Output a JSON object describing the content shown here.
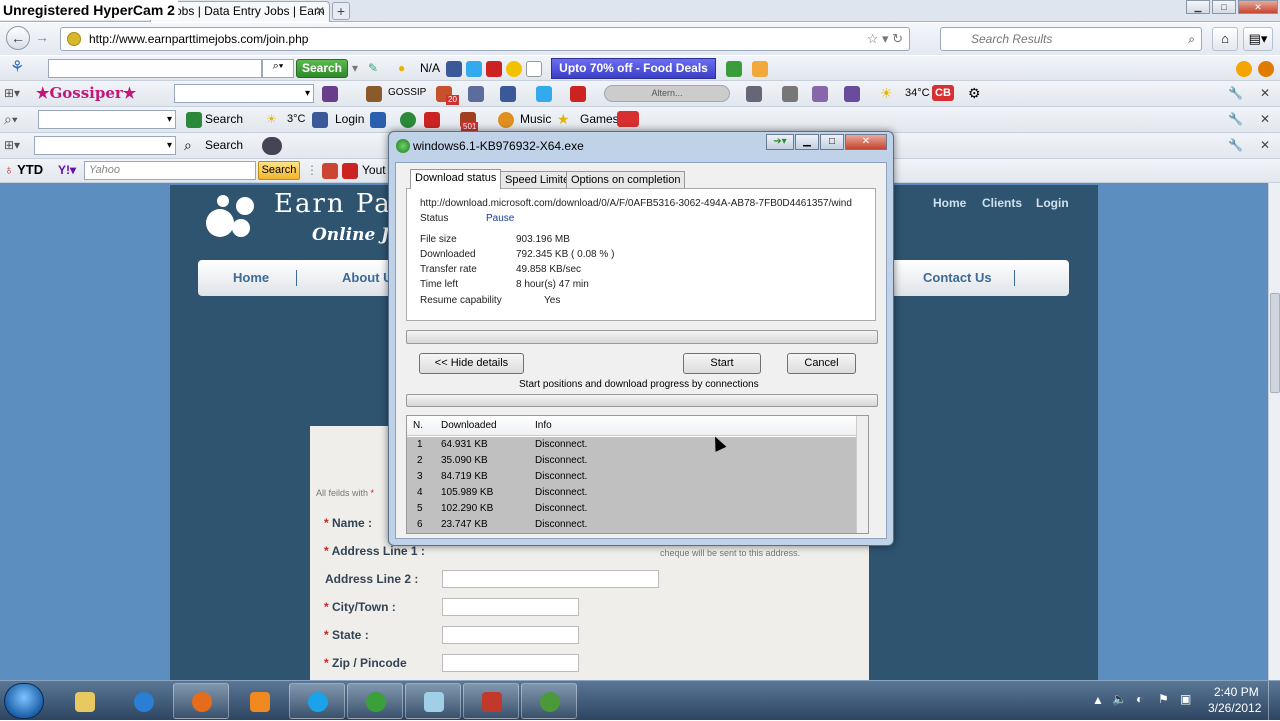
{
  "recorder": {
    "watermark": "Unregistered HyperCam 2"
  },
  "browser": {
    "tab_title": "e Jobs | Data Entry Jobs | Earn M...",
    "new_tab": "+",
    "url": "http://www.earnparttimejobs.com/join.php",
    "search_placeholder": "Search Results"
  },
  "toolbars": {
    "search_button": "Search",
    "na": "N/A",
    "deal_button": "Upto 70% off - Food Deals",
    "gossiper": "Gossiper",
    "gossip_label": "GOSSIP",
    "badge_20": "20",
    "altern": "Altern...",
    "temp1": "34°C",
    "cb": "CB",
    "search_label": "Search",
    "temp2": "3°C",
    "login": "Login",
    "badge_501": "501",
    "music": "Music",
    "games": "Games",
    "search_label2": "Search",
    "ytd": "YTD",
    "yahoo_placeholder": "Yahoo",
    "search_button2": "Search",
    "youtube_text": "Yout"
  },
  "site": {
    "logo_text": "Earn Pa",
    "logo_sub": "Online Jo",
    "top_links": [
      "Home",
      "Clients",
      "Login"
    ],
    "menu": [
      "Home",
      "About U",
      "Contact Us"
    ],
    "form_note": "All feilds with",
    "fields": [
      {
        "label": "Name :",
        "required": true
      },
      {
        "label": "Address Line 1 :",
        "required": true
      },
      {
        "label": "Address Line 2 :",
        "required": false
      },
      {
        "label": "City/Town :",
        "required": true
      },
      {
        "label": "State :",
        "required": true
      },
      {
        "label": "Zip / Pincode",
        "required": true
      }
    ],
    "address_note": "cheque will be sent to this address."
  },
  "dialog": {
    "title": "windows6.1-KB976932-X64.exe",
    "tabs": [
      "Download status",
      "Speed Limiter",
      "Options on completion"
    ],
    "url": "http://download.microsoft.com/download/0/A/F/0AFB5316-3062-494A-AB78-7FB0D4461357/wind",
    "status_label": "Status",
    "status_value": "Pause",
    "file_size_label": "File size",
    "file_size": "903.196  MB",
    "downloaded_label": "Downloaded",
    "downloaded": "792.345  KB  ( 0.08 % )",
    "rate_label": "Transfer rate",
    "rate": "49.858  KB/sec",
    "time_left_label": "Time left",
    "time_left": "8 hour(s) 47 min",
    "resume_label": "Resume capability",
    "resume": "Yes",
    "hide_details": "<< Hide details",
    "start": "Start",
    "cancel": "Cancel",
    "connections_caption": "Start positions and download progress by connections",
    "columns": [
      "N.",
      "Downloaded",
      "Info"
    ],
    "rows": [
      {
        "n": "1",
        "downloaded": "64.931  KB",
        "info": "Disconnect."
      },
      {
        "n": "2",
        "downloaded": "35.090  KB",
        "info": "Disconnect."
      },
      {
        "n": "3",
        "downloaded": "84.719  KB",
        "info": "Disconnect."
      },
      {
        "n": "4",
        "downloaded": "105.989  KB",
        "info": "Disconnect."
      },
      {
        "n": "5",
        "downloaded": "102.290  KB",
        "info": "Disconnect."
      },
      {
        "n": "6",
        "downloaded": "23.747  KB",
        "info": "Disconnect."
      }
    ]
  },
  "taskbar": {
    "time": "2:40 PM",
    "date": "3/26/2012"
  }
}
